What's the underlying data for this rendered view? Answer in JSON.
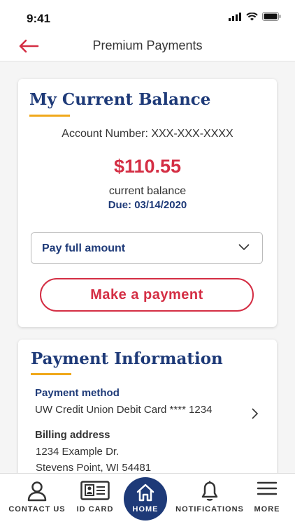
{
  "status": {
    "time": "9:41"
  },
  "header": {
    "title": "Premium Payments"
  },
  "balance_card": {
    "title": "My Current Balance",
    "account": "Account Number: XXX-XXX-XXXX",
    "amount": "$110.55",
    "balance_label": "current balance",
    "due": "Due: 03/14/2020",
    "select_value": "Pay full amount",
    "pay_button": "Make a payment"
  },
  "payment_card": {
    "title": "Payment Information",
    "method_label": "Payment method",
    "method_value": "UW Credit Union Debit Card **** 1234",
    "billing_label": "Billing address",
    "address_line1": "1234 Example Dr.",
    "address_line2": "Stevens Point, WI 54481"
  },
  "tabs": [
    {
      "label": "CONTACT US",
      "icon": "person-icon"
    },
    {
      "label": "ID CARD",
      "icon": "id-card-icon"
    },
    {
      "label": "HOME",
      "icon": "home-icon"
    },
    {
      "label": "NOTIFICATIONS",
      "icon": "bell-icon"
    },
    {
      "label": "MORE",
      "icon": "menu-icon"
    }
  ],
  "colors": {
    "primary": "#1e3a78",
    "accent": "#d42e44",
    "underline": "#f0a81a"
  }
}
